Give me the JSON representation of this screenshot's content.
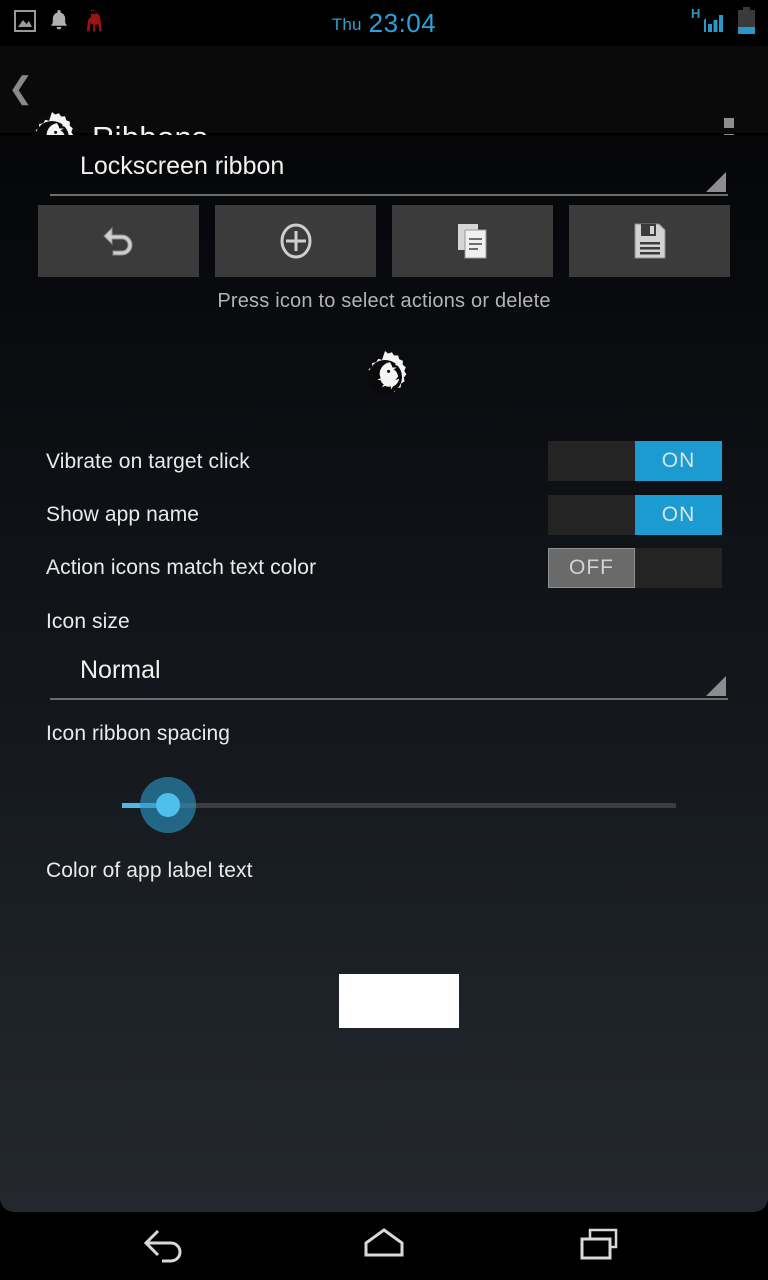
{
  "statusbar": {
    "icons": [
      "image-icon",
      "bell-icon",
      "llama-icon"
    ],
    "clock_day": "Thu",
    "clock_time": "23:04",
    "network_type": "H",
    "signal_icon": "signal-bars-icon",
    "battery_icon": "battery-icon",
    "accent_color": "#29a3dd"
  },
  "appbar": {
    "back_icon": "back-chevron-icon",
    "logo_icon": "gear-unicorn-logo-icon",
    "title": "Ribbons",
    "overflow_icon": "overflow-menu-icon",
    "accent_line_color": "#29a3dd"
  },
  "ribbon_spinner": {
    "value": "Lockscreen ribbon",
    "arrow_icon": "dropdown-triangle-icon"
  },
  "toolbar": {
    "buttons": [
      {
        "name": "revert-button",
        "icon": "undo-arrow-icon"
      },
      {
        "name": "add-button",
        "icon": "plus-circle-icon"
      },
      {
        "name": "copy-button",
        "icon": "copy-documents-icon"
      },
      {
        "name": "save-button",
        "icon": "floppy-disk-icon"
      }
    ]
  },
  "hint": {
    "text": "Press icon to select actions or delete"
  },
  "ribbon_preview": {
    "icon": "gear-unicorn-logo-icon"
  },
  "settings": {
    "rows": [
      {
        "label": "Vibrate on target click",
        "state": "ON"
      },
      {
        "label": "Show app name",
        "state": "ON"
      },
      {
        "label": "Action icons match text color",
        "state": "OFF"
      }
    ],
    "icon_size": {
      "label": "Icon size",
      "value": "Normal"
    },
    "spacing": {
      "label": "Icon ribbon spacing",
      "percent": 8
    },
    "label_color": {
      "label": "Color of app label text",
      "swatch": "#ffffff"
    }
  },
  "navbar": {
    "back": "nav-back-icon",
    "home": "nav-home-icon",
    "recents": "nav-recents-icon"
  }
}
